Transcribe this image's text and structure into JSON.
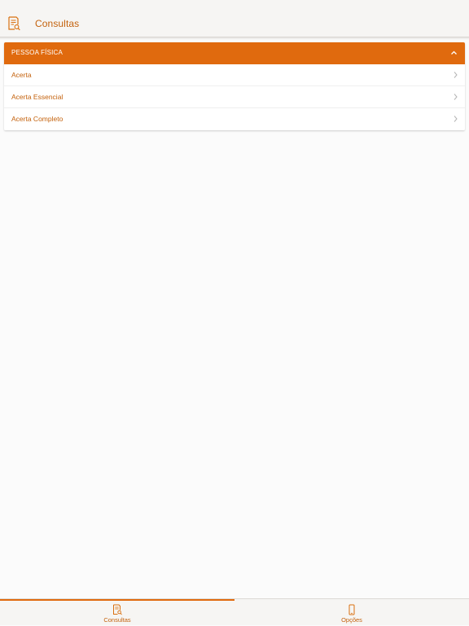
{
  "header": {
    "title": "Consultas",
    "icon": "document-search-icon"
  },
  "section": {
    "title": "PESSOA FÍSICA",
    "expanded": true,
    "items": [
      {
        "label": "Acerta"
      },
      {
        "label": "Acerta Essencial"
      },
      {
        "label": "Acerta Completo"
      }
    ]
  },
  "tabs": [
    {
      "label": "Consultas",
      "icon": "document-search-icon",
      "selected": true
    },
    {
      "label": "Opções",
      "icon": "phone-icon",
      "selected": false
    }
  ],
  "colors": {
    "accent": "#e06a0e",
    "accent_text": "#c4620d",
    "background": "#fbfbfb",
    "bar": "#f6f5f3"
  }
}
